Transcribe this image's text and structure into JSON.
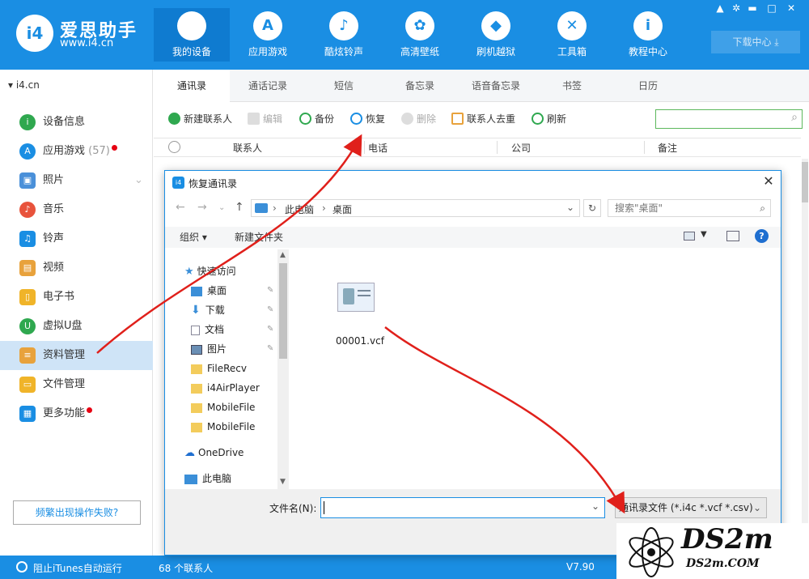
{
  "brand": {
    "name": "爱思助手",
    "url": "www.i4.cn",
    "logo": "i4"
  },
  "nav": [
    {
      "label": "我的设备",
      "icon": "apple-icon",
      "glyph": ""
    },
    {
      "label": "应用游戏",
      "icon": "appstore-icon",
      "glyph": "A"
    },
    {
      "label": "酷炫铃声",
      "icon": "bell-icon",
      "glyph": "♪"
    },
    {
      "label": "高清壁纸",
      "icon": "flower-icon",
      "glyph": "✿"
    },
    {
      "label": "刷机越狱",
      "icon": "box-icon",
      "glyph": "◆"
    },
    {
      "label": "工具箱",
      "icon": "tools-icon",
      "glyph": "✕"
    },
    {
      "label": "教程中心",
      "icon": "info-icon",
      "glyph": "i"
    }
  ],
  "window_controls": [
    "shirt-icon",
    "gear-icon",
    "minimize-icon",
    "maximize-icon",
    "close-icon"
  ],
  "download_center": "下载中心 ⤓",
  "device": "▾  i4.cn",
  "sidebar": [
    {
      "label": "设备信息",
      "color": "#2fa84f",
      "glyph": "i"
    },
    {
      "label": "应用游戏",
      "color": "#1a8ee3",
      "glyph": "A",
      "badge": "(57)"
    },
    {
      "label": "照片",
      "color": "#4a90d9",
      "glyph": "▣"
    },
    {
      "label": "音乐",
      "color": "#e8533c",
      "glyph": "♪"
    },
    {
      "label": "铃声",
      "color": "#1a8ee3",
      "glyph": "♫"
    },
    {
      "label": "视频",
      "color": "#e8a23c",
      "glyph": "▤"
    },
    {
      "label": "电子书",
      "color": "#f0b429",
      "glyph": "▯"
    },
    {
      "label": "虚拟U盘",
      "color": "#2fa84f",
      "glyph": "U"
    },
    {
      "label": "资料管理",
      "color": "#e8a23c",
      "glyph": "≡"
    },
    {
      "label": "文件管理",
      "color": "#f0b429",
      "glyph": "▭"
    },
    {
      "label": "更多功能",
      "color": "#1a8ee3",
      "glyph": "▦"
    }
  ],
  "fail_button": "频繁出现操作失败?",
  "status": {
    "itunes": "阻止iTunes自动运行",
    "count": "68 个联系人",
    "version": "V7.90"
  },
  "tabs": [
    "通讯录",
    "通话记录",
    "短信",
    "备忘录",
    "语音备忘录",
    "书签",
    "日历"
  ],
  "toolbar": [
    {
      "label": "新建联系人",
      "color": "#2fa84f"
    },
    {
      "label": "编辑",
      "color": "#bbb"
    },
    {
      "label": "备份",
      "color": "#2fa84f"
    },
    {
      "label": "恢复",
      "color": "#1a8ee3"
    },
    {
      "label": "删除",
      "color": "#ccc"
    },
    {
      "label": "联系人去重",
      "color": "#e8a23c"
    },
    {
      "label": "刷新",
      "color": "#2fa84f"
    }
  ],
  "columns": [
    "联系人",
    "电话",
    "公司",
    "备注"
  ],
  "dialog": {
    "title": "恢复通讯录",
    "path": [
      "此电脑",
      "桌面"
    ],
    "search_placeholder": "搜索\"桌面\"",
    "organize": "组织 ▾",
    "new_folder": "新建文件夹",
    "tree": [
      {
        "label": "快速访问",
        "icon": "star-icon",
        "color": "#3b8fd8"
      },
      {
        "label": "桌面",
        "icon": "desktop-icon",
        "color": "#3b8fd8",
        "pin": true
      },
      {
        "label": "下载",
        "icon": "download-icon",
        "color": "#3b8fd8",
        "pin": true
      },
      {
        "label": "文档",
        "icon": "document-icon",
        "color": "#9aa",
        "pin": true
      },
      {
        "label": "图片",
        "icon": "pictures-icon",
        "color": "#6a8fb5",
        "pin": true
      },
      {
        "label": "FileRecv",
        "icon": "folder-icon",
        "color": "#f3cc5c"
      },
      {
        "label": "i4AirPlayer",
        "icon": "folder-icon",
        "color": "#f3cc5c"
      },
      {
        "label": "MobileFile",
        "icon": "folder-icon",
        "color": "#f3cc5c"
      },
      {
        "label": "MobileFile",
        "icon": "folder-icon",
        "color": "#f3cc5c"
      },
      {
        "label": "OneDrive",
        "icon": "cloud-icon",
        "color": "#1f6fd0"
      },
      {
        "label": "此电脑",
        "icon": "computer-icon",
        "color": "#3b8fd8"
      }
    ],
    "file": "00001.vcf",
    "filename_label": "文件名(N):",
    "filename_value": "",
    "filetype": "通讯录文件 (*.i4c *.vcf *.csv)"
  },
  "watermark": {
    "main": "DS2m",
    "sub": "DS2m.COM"
  }
}
